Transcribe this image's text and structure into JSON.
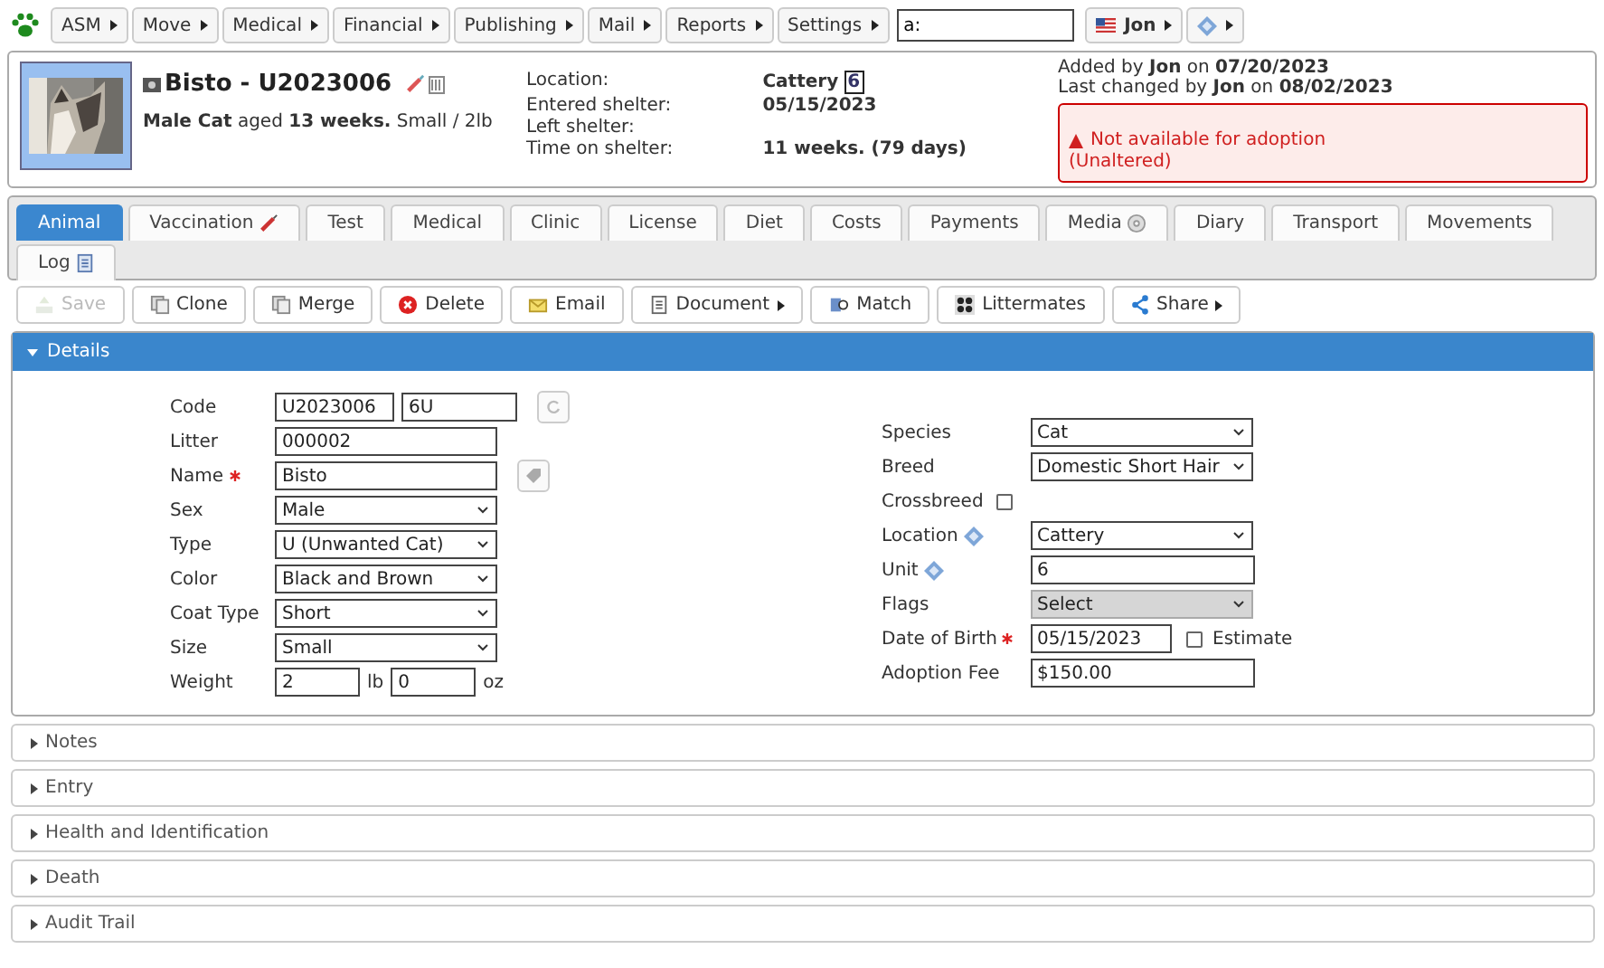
{
  "menubar": {
    "items": [
      {
        "label": "ASM"
      },
      {
        "label": "Move"
      },
      {
        "label": "Medical"
      },
      {
        "label": "Financial"
      },
      {
        "label": "Publishing"
      },
      {
        "label": "Mail"
      },
      {
        "label": "Reports"
      },
      {
        "label": "Settings"
      }
    ],
    "search": {
      "value": "a:"
    },
    "user": {
      "label": "Jon"
    }
  },
  "header": {
    "name": "Bisto - U2023006",
    "summary": "**Male Cat** aged **13 weeks.** Small / 2lb",
    "info": [
      {
        "label": "Location:",
        "value": "Cattery",
        "unit": "6"
      },
      {
        "label": "Entered shelter:",
        "value": "05/15/2023"
      },
      {
        "label": "Left shelter:"
      },
      {
        "label": "Time on shelter:",
        "value": "11 weeks. (79 days)"
      }
    ],
    "audit": [
      "Added by **Jon** on **07/20/2023**",
      "Last changed by **Jon** on **08/02/2023**"
    ],
    "alert": [
      "Not available for adoption",
      "(Unaltered)"
    ]
  },
  "tabs": [
    {
      "label": "Animal",
      "selected": true
    },
    {
      "label": "Vaccination",
      "selected": false
    },
    {
      "label": "Test",
      "selected": false
    },
    {
      "label": "Medical",
      "selected": false
    },
    {
      "label": "Clinic",
      "selected": false
    },
    {
      "label": "License",
      "selected": false
    },
    {
      "label": "Diet",
      "selected": false
    },
    {
      "label": "Costs",
      "selected": false
    },
    {
      "label": "Payments",
      "selected": false
    },
    {
      "label": "Media",
      "selected": false
    },
    {
      "label": "Diary",
      "selected": false
    },
    {
      "label": "Transport",
      "selected": false
    },
    {
      "label": "Movements",
      "selected": false
    },
    {
      "label": "Log",
      "selected": false
    }
  ],
  "toolbar": [
    {
      "label": "Save",
      "disabled": true,
      "menu": false
    },
    {
      "label": "Clone",
      "disabled": false,
      "menu": false
    },
    {
      "label": "Merge",
      "disabled": false,
      "menu": false
    },
    {
      "label": "Delete",
      "disabled": false,
      "menu": false
    },
    {
      "label": "Email",
      "disabled": false,
      "menu": false
    },
    {
      "label": "Document",
      "disabled": false,
      "menu": true
    },
    {
      "label": "Match",
      "disabled": false,
      "menu": false
    },
    {
      "label": "Littermates",
      "disabled": false,
      "menu": false
    },
    {
      "label": "Share",
      "disabled": false,
      "menu": true
    }
  ],
  "details": {
    "title": "Details",
    "expanded": true,
    "left": [
      {
        "kind": "code",
        "label": "Code",
        "required": false,
        "value": "U2023006",
        "value2": "6U"
      },
      {
        "kind": "text",
        "label": "Litter",
        "required": false,
        "value": "000002"
      },
      {
        "kind": "name",
        "label": "Name",
        "required": true,
        "value": "Bisto"
      },
      {
        "kind": "select",
        "label": "Sex",
        "required": false,
        "value": "Male"
      },
      {
        "kind": "select",
        "label": "Type",
        "required": false,
        "value": "U (Unwanted Cat)"
      },
      {
        "kind": "select",
        "label": "Color",
        "required": false,
        "value": "Black and Brown"
      },
      {
        "kind": "select",
        "label": "Coat Type",
        "required": false,
        "value": "Short"
      },
      {
        "kind": "select",
        "label": "Size",
        "required": false,
        "value": "Small"
      },
      {
        "kind": "weight",
        "label": "Weight",
        "required": false,
        "value": "2",
        "unit": "lb",
        "value2": "0",
        "unit2": "oz"
      }
    ],
    "right": [
      {
        "kind": "select",
        "label": "Species",
        "required": false,
        "lookup": false,
        "value": "Cat"
      },
      {
        "kind": "select",
        "label": "Breed",
        "required": false,
        "lookup": false,
        "value": "Domestic Short Hair"
      },
      {
        "kind": "checkbox",
        "label": "Crossbreed",
        "required": false,
        "lookup": false,
        "checked": false
      },
      {
        "kind": "select",
        "label": "Location",
        "required": false,
        "lookup": true,
        "value": "Cattery"
      },
      {
        "kind": "text",
        "label": "Unit",
        "required": false,
        "lookup": true,
        "value": "6"
      },
      {
        "kind": "multiselect",
        "label": "Flags",
        "required": false,
        "lookup": false,
        "value": "Select"
      },
      {
        "kind": "date",
        "label": "Date of Birth",
        "required": true,
        "lookup": false,
        "value": "05/15/2023",
        "option": {
          "label": "Estimate",
          "checked": false
        }
      },
      {
        "kind": "text",
        "label": "Adoption Fee",
        "required": false,
        "lookup": false,
        "value": "$150.00"
      }
    ]
  },
  "sections": [
    {
      "title": "Notes",
      "expanded": false
    },
    {
      "title": "Entry",
      "expanded": false
    },
    {
      "title": "Health and Identification",
      "expanded": false
    },
    {
      "title": "Death",
      "expanded": false
    },
    {
      "title": "Audit Trail",
      "expanded": false
    }
  ]
}
